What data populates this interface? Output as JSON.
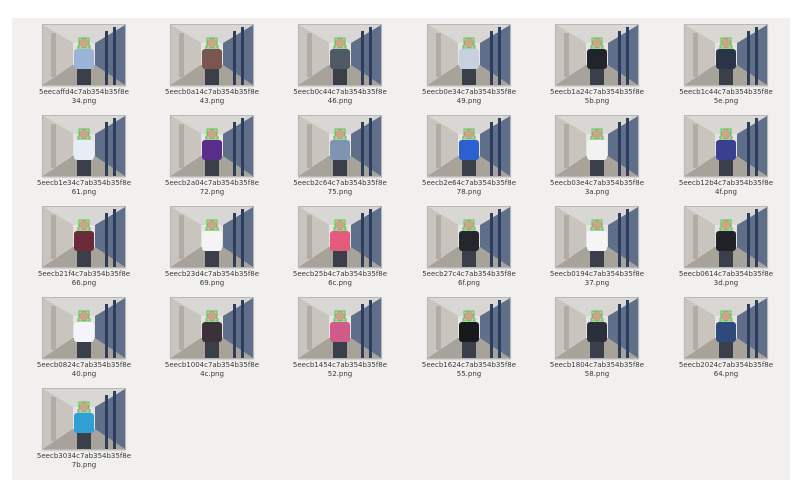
{
  "files": [
    {
      "l1": "5eecaffd4c7ab354b35f8e",
      "l2": "34.png",
      "shirt": "#9ab3d6"
    },
    {
      "l1": "5eecb0a14c7ab354b35f8e",
      "l2": "43.png",
      "shirt": "#7a5650"
    },
    {
      "l1": "5eecb0c44c7ab354b35f8e",
      "l2": "46.png",
      "shirt": "#4f5a66"
    },
    {
      "l1": "5eecb0e34c7ab354b35f8e",
      "l2": "49.png",
      "shirt": "#c7cfe0"
    },
    {
      "l1": "5eecb1a24c7ab354b35f8e",
      "l2": "5b.png",
      "shirt": "#20242c"
    },
    {
      "l1": "5eecb1c44c7ab354b35f8e",
      "l2": "5e.png",
      "shirt": "#2a3446"
    },
    {
      "l1": "5eecb1e34c7ab354b35f8e",
      "l2": "61.png",
      "shirt": "#e8ecf5"
    },
    {
      "l1": "5eecb2a04c7ab354b35f8e",
      "l2": "72.png",
      "shirt": "#5b2d8a"
    },
    {
      "l1": "5eecb2c64c7ab354b35f8e",
      "l2": "75.png",
      "shirt": "#7f93b3"
    },
    {
      "l1": "5eecb2e64c7ab354b35f8e",
      "l2": "78.png",
      "shirt": "#2c5fd0"
    },
    {
      "l1": "5eecb03e4c7ab354b35f8e",
      "l2": "3a.png",
      "shirt": "#f2f2f2"
    },
    {
      "l1": "5eecb12b4c7ab354b35f8e",
      "l2": "4f.png",
      "shirt": "#3a3f8f"
    },
    {
      "l1": "5eecb21f4c7ab354b35f8e",
      "l2": "66.png",
      "shirt": "#6a2a3a"
    },
    {
      "l1": "5eecb23d4c7ab354b35f8e",
      "l2": "69.png",
      "shirt": "#f4f4f4"
    },
    {
      "l1": "5eecb25b4c7ab354b35f8e",
      "l2": "6c.png",
      "shirt": "#e45b7d"
    },
    {
      "l1": "5eecb27c4c7ab354b35f8e",
      "l2": "6f.png",
      "shirt": "#24272c"
    },
    {
      "l1": "5eecb0194c7ab354b35f8e",
      "l2": "37.png",
      "shirt": "#f5f5f5"
    },
    {
      "l1": "5eecb0614c7ab354b35f8e",
      "l2": "3d.png",
      "shirt": "#1f2226"
    },
    {
      "l1": "5eecb0824c7ab354b35f8e",
      "l2": "40.png",
      "shirt": "#f3f5fa"
    },
    {
      "l1": "5eecb1004c7ab354b35f8e",
      "l2": "4c.png",
      "shirt": "#3a3238"
    },
    {
      "l1": "5eecb1454c7ab354b35f8e",
      "l2": "52.png",
      "shirt": "#d05a8a"
    },
    {
      "l1": "5eecb1624c7ab354b35f8e",
      "l2": "55.png",
      "shirt": "#18191c"
    },
    {
      "l1": "5eecb1804c7ab354b35f8e",
      "l2": "58.png",
      "shirt": "#2b2f3a"
    },
    {
      "l1": "5eecb2024c7ab354b35f8e",
      "l2": "64.png",
      "shirt": "#2d4a7a"
    },
    {
      "l1": "5eecb3034c7ab354b35f8e",
      "l2": "7b.png",
      "shirt": "#2f9fd6"
    }
  ]
}
